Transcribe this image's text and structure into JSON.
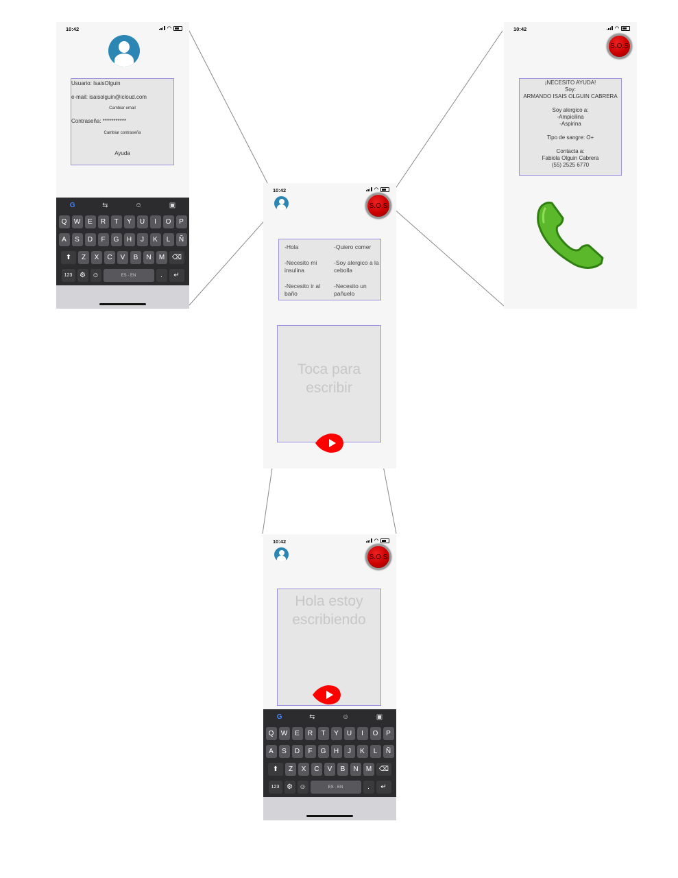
{
  "status": {
    "time": "10:42"
  },
  "profile": {
    "user_text": "Usuario: IsaisOlguin",
    "email_text": "e-mail: isaisolguin@icloud.com",
    "change_email": "Cambiar email",
    "password_text": "Contraseña: ***********",
    "change_password": "Cambiar contraseña",
    "help": "Ayuda"
  },
  "main": {
    "sos_label": "S.O.S",
    "phrases": [
      {
        "text": "-Hola"
      },
      {
        "text": "-Quiero comer"
      },
      {
        "text": "-Necesito mi insulina"
      },
      {
        "text": "-Soy alergico a la cebolla"
      },
      {
        "text": "-Necesito ir al baño"
      },
      {
        "text": "-Necesito un pañuelo"
      }
    ],
    "placeholder": "Toca para escribir"
  },
  "writing": {
    "text": "Hola estoy escribiendo"
  },
  "emergency": {
    "sos_label": "S.O.S",
    "title": "¡NECESITO AYUDA!",
    "soy": "Soy:",
    "name": "ARMANDO ISAIS OLGUIN CABRERA",
    "allergic_header": "Soy alergico a:",
    "allergies": [
      "-Ampicilina",
      "-Aspirina"
    ],
    "blood": "Tipo de sangre: O+",
    "contact_header": "Contacta a:",
    "contact_name": "Fabiola Olguin Cabrera",
    "contact_phone": "(55) 2525 6770"
  },
  "keyboard": {
    "row1": [
      "Q",
      "W",
      "E",
      "R",
      "T",
      "Y",
      "U",
      "I",
      "O",
      "P"
    ],
    "row2": [
      "A",
      "S",
      "D",
      "F",
      "G",
      "H",
      "J",
      "K",
      "L",
      "Ñ"
    ],
    "row3": [
      "Z",
      "X",
      "C",
      "V",
      "B",
      "N",
      "M"
    ],
    "numbers_key": "123",
    "space_label": "ES · EN",
    "period": "."
  },
  "colors": {
    "sos_red": "#cc0000",
    "avatar_blue": "#2b86b3",
    "box_border": "#9b8fe0",
    "phone_green": "#5ab82a",
    "play_red": "#ff0000"
  }
}
